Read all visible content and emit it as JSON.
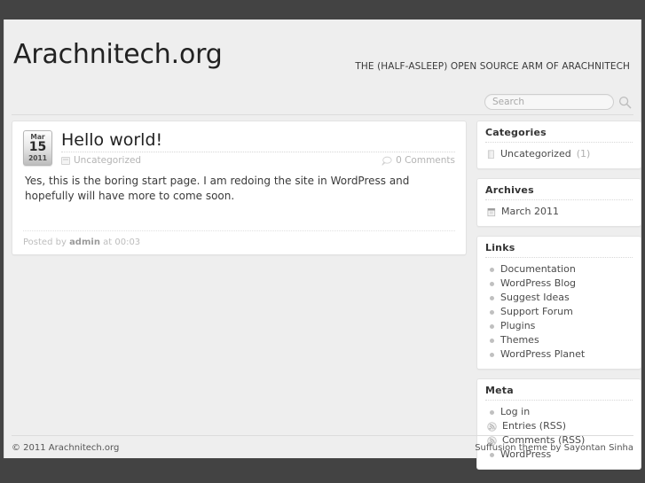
{
  "site": {
    "title": "Arachnitech.org",
    "tagline": "THE (HALF-ASLEEP) OPEN SOURCE ARM OF ARACHNITECH"
  },
  "search": {
    "placeholder": "Search",
    "value": "",
    "icon": "search-icon"
  },
  "post": {
    "date": {
      "month": "Mar",
      "day": "15",
      "year": "2011"
    },
    "title": "Hello world!",
    "category": "Uncategorized",
    "category_icon": "category-icon",
    "comments": "0 Comments",
    "comments_icon": "comment-bubble-icon",
    "body": "Yes, this is the boring start page.  I am redoing the site in WordPress and hopefully will have more to come soon.",
    "footer_prefix": "Posted by",
    "author": "admin",
    "footer_suffix": "at 00:03"
  },
  "sidebar": {
    "widgets": [
      {
        "title": "Categories",
        "items": [
          {
            "icon": "book-icon",
            "label": "Uncategorized",
            "count": "(1)"
          }
        ]
      },
      {
        "title": "Archives",
        "items": [
          {
            "icon": "calendar-icon",
            "label": "March 2011",
            "count": ""
          }
        ]
      },
      {
        "title": "Links",
        "items": [
          {
            "icon": "bullet-icon",
            "label": "Documentation",
            "count": ""
          },
          {
            "icon": "bullet-icon",
            "label": "WordPress Blog",
            "count": ""
          },
          {
            "icon": "bullet-icon",
            "label": "Suggest Ideas",
            "count": ""
          },
          {
            "icon": "bullet-icon",
            "label": "Support Forum",
            "count": ""
          },
          {
            "icon": "bullet-icon",
            "label": "Plugins",
            "count": ""
          },
          {
            "icon": "bullet-icon",
            "label": "Themes",
            "count": ""
          },
          {
            "icon": "bullet-icon",
            "label": "WordPress Planet",
            "count": ""
          }
        ]
      },
      {
        "title": "Meta",
        "items": [
          {
            "icon": "bullet-icon",
            "label": "Log in",
            "count": ""
          },
          {
            "icon": "rss-icon",
            "label": "Entries (RSS)",
            "count": ""
          },
          {
            "icon": "rss-icon",
            "label": "Comments (RSS)",
            "count": ""
          },
          {
            "icon": "bullet-icon",
            "label": "WordPress",
            "count": ""
          }
        ]
      }
    ]
  },
  "footer": {
    "copyright": "© 2011 Arachnitech.org",
    "credit": "Suffusion theme by Sayontan Sinha"
  },
  "colors": {
    "chrome": "#434343",
    "page_bg": "#eeeeee",
    "box_bg": "#ffffff",
    "border": "#e2e2e2",
    "text": "#333333",
    "muted": "#b4b4b4"
  }
}
